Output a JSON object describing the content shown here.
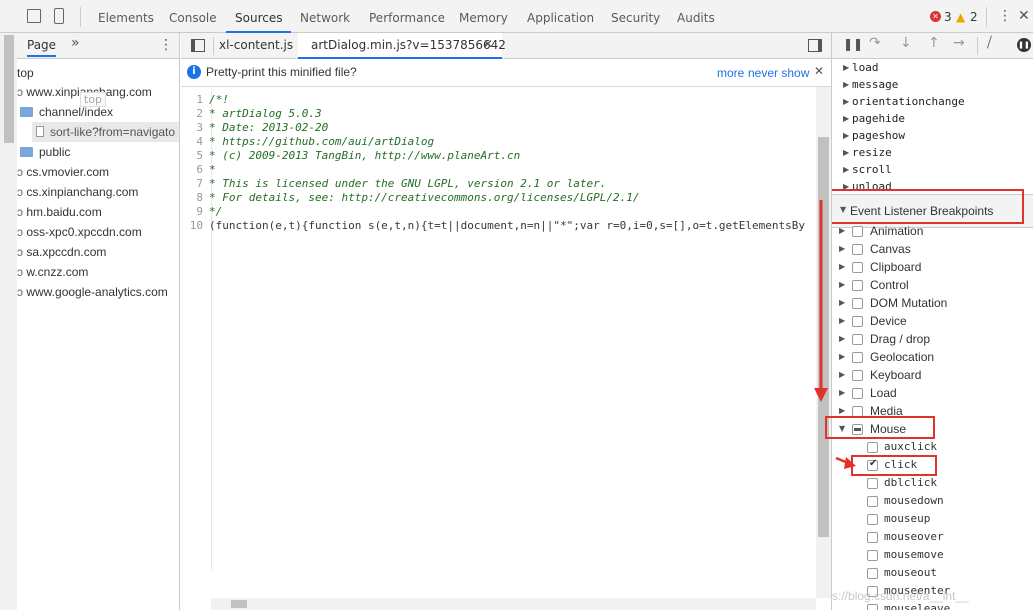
{
  "toolbar": {
    "tabs": [
      "Elements",
      "Console",
      "Sources",
      "Network",
      "Performance",
      "Memory",
      "Application",
      "Security",
      "Audits"
    ],
    "active_tab": "Sources",
    "error_count": "3",
    "warning_count": "2"
  },
  "navigator": {
    "tab_label": "Page",
    "more_label": "»",
    "tree": [
      "top",
      "www.xinpianchang.com",
      "channel/index",
      "sort-like?from=navigato",
      "public",
      "cs.vmovier.com",
      "cs.xinpianchang.com",
      "hm.baidu.com",
      "oss-xpc0.xpccdn.com",
      "sa.xpccdn.com",
      "w.cnzz.com",
      "www.google-analytics.com"
    ],
    "tooltip": "top"
  },
  "editor": {
    "tabs": [
      "xl-content.js",
      "artDialog.min.js?v=1537856642"
    ],
    "active_tab": "artDialog.min.js?v=1537856642",
    "infobar_text": "Pretty-print this minified file?",
    "infobar_more": "more",
    "infobar_never": "never show",
    "lines": [
      {
        "n": "1",
        "t": "/*!"
      },
      {
        "n": "2",
        "t": "* artDialog 5.0.3"
      },
      {
        "n": "3",
        "t": "* Date: 2013-02-20"
      },
      {
        "n": "4",
        "t": "* https://github.com/aui/artDialog"
      },
      {
        "n": "5",
        "t": "* (c) 2009-2013 TangBin, http://www.planeArt.cn"
      },
      {
        "n": "6",
        "t": "*"
      },
      {
        "n": "7",
        "t": "* This is licensed under the GNU LGPL, version 2.1 or later."
      },
      {
        "n": "8",
        "t": "* For details, see: http://creativecommons.org/licenses/LGPL/2.1/"
      },
      {
        "n": "9",
        "t": "*/"
      },
      {
        "n": "10",
        "t": "(function(e,t){function s(e,t,n){t=t||document,n=n||\"*\";var r=0,i=0,s=[],o=t.getElementsBy"
      }
    ]
  },
  "events": [
    "load",
    "message",
    "orientationchange",
    "pagehide",
    "pageshow",
    "resize",
    "scroll",
    "unload"
  ],
  "breakpoints": {
    "section_title": "Event Listener Breakpoints",
    "categories": [
      "Animation",
      "Canvas",
      "Clipboard",
      "Control",
      "DOM Mutation",
      "Device",
      "Drag / drop",
      "Geolocation",
      "Keyboard",
      "Load",
      "Media",
      "Mouse"
    ],
    "mouse_events": [
      "auxclick",
      "click",
      "dblclick",
      "mousedown",
      "mouseup",
      "mouseover",
      "mousemove",
      "mouseout",
      "mouseenter",
      "mouseleave"
    ],
    "checked_event": "click"
  },
  "watermark": "https://blog.csdn.net/a__int__",
  "colors": {
    "accent": "#1a73e8",
    "highlight": "#e0332b",
    "comment": "#236e25"
  }
}
